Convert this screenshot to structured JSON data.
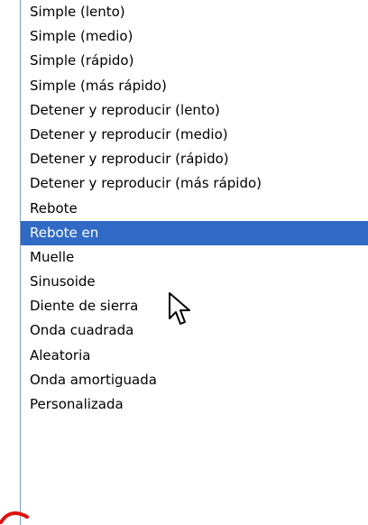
{
  "dropdown": {
    "items": [
      {
        "label": "Simple (lento)",
        "selected": false
      },
      {
        "label": "Simple (medio)",
        "selected": false
      },
      {
        "label": "Simple (rápido)",
        "selected": false
      },
      {
        "label": "Simple (más rápido)",
        "selected": false
      },
      {
        "label": "Detener y reproducir (lento)",
        "selected": false
      },
      {
        "label": "Detener y reproducir (medio)",
        "selected": false
      },
      {
        "label": "Detener y reproducir (rápido)",
        "selected": false
      },
      {
        "label": "Detener y reproducir (más rápido)",
        "selected": false
      },
      {
        "label": "Rebote",
        "selected": false
      },
      {
        "label": "Rebote en",
        "selected": true
      },
      {
        "label": "Muelle",
        "selected": false
      },
      {
        "label": "Sinusoide",
        "selected": false
      },
      {
        "label": "Diente de sierra",
        "selected": false
      },
      {
        "label": "Onda cuadrada",
        "selected": false
      },
      {
        "label": "Aleatoria",
        "selected": false
      },
      {
        "label": "Onda amortiguada",
        "selected": false
      },
      {
        "label": "Personalizada",
        "selected": false
      }
    ]
  },
  "colors": {
    "highlight": "#316ac5",
    "highlight_text": "#ffffff",
    "edge_mark": "#e01010"
  },
  "icons": {
    "cursor": "mouse-pointer-icon",
    "edge": "red-swoosh-icon"
  }
}
